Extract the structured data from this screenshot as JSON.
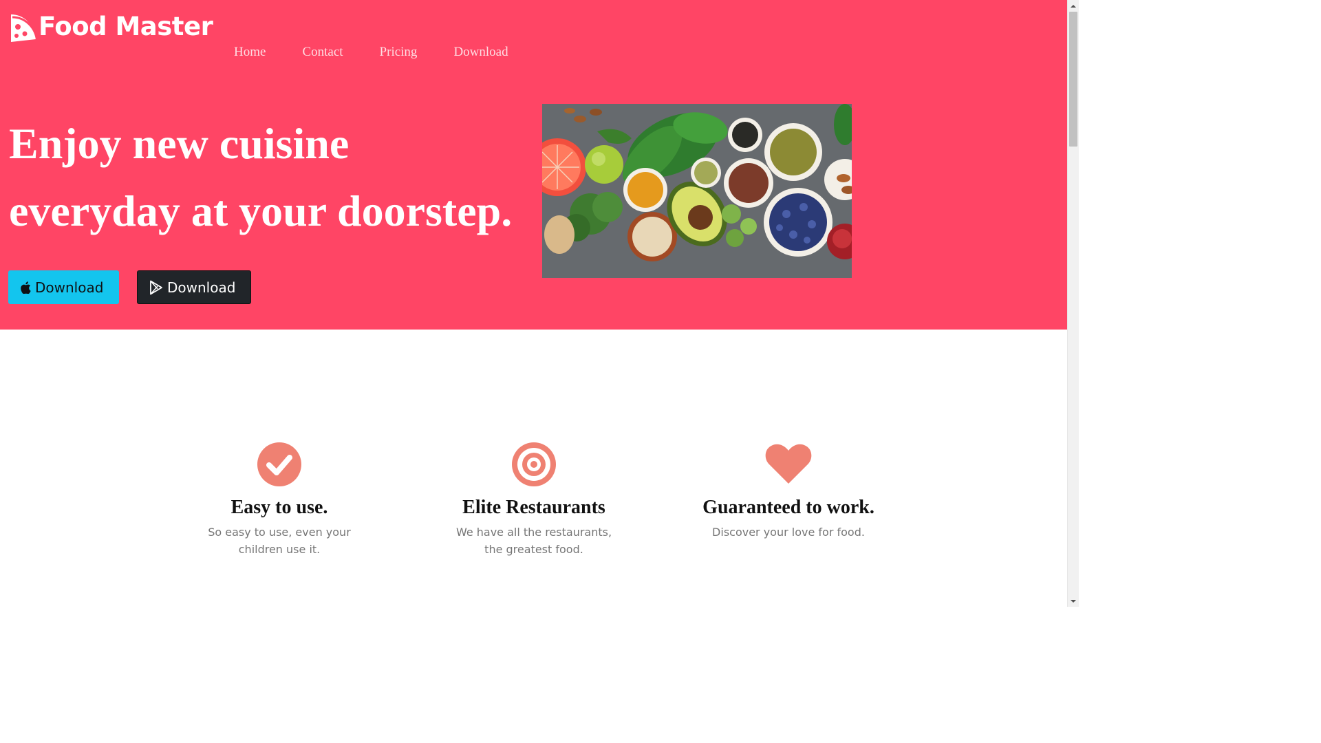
{
  "brand": {
    "name": "Food Master",
    "icon": "pizza-slice-icon"
  },
  "nav": {
    "items": [
      "Home",
      "Contact",
      "Pricing",
      "Download"
    ]
  },
  "hero": {
    "headline_line1": "Enjoy new cuisine",
    "headline_line2": "everyday at your doorstep.",
    "apple_button": {
      "label": "Download",
      "icon": "apple-icon"
    },
    "play_button": {
      "label": "Download",
      "icon": "google-play-icon"
    },
    "image_alt": "healthy-food-spread"
  },
  "features": [
    {
      "icon": "check-circle-icon",
      "title": "Easy to use.",
      "text": "So easy to use, even your children use it."
    },
    {
      "icon": "bullseye-icon",
      "title": "Elite Restaurants",
      "text": "We have all the restaurants, the greatest food."
    },
    {
      "icon": "heart-icon",
      "title": "Guaranteed to work.",
      "text": "Discover your love for food."
    }
  ],
  "colors": {
    "hero_bg": "#ff4565",
    "apple_button": "#13c5ee",
    "play_button": "#212529",
    "feature_icon": "#ef8172"
  }
}
